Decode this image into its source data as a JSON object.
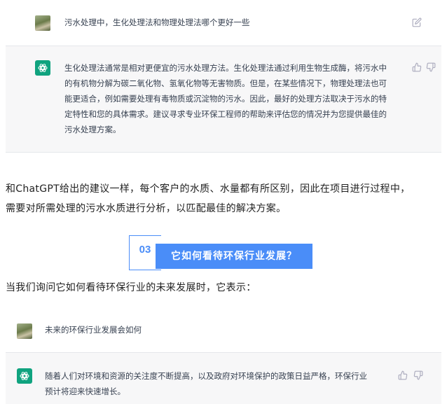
{
  "conversation1": {
    "user_message": "污水处理中，生化处理法和物理处理法哪个更好一些",
    "bot_lines": [
      "生化处理法通常是相对更便宜的污水处理方法。生化处理法通过利用生物生成酶，将污水中",
      "的有机物分解为碳二氧化物、氢氧化物等无害物质。但是，在某些情况下，物理处理法也可",
      "能更适合，例如需要处理有毒物质或沉淀物的污水。因此，最好的处理方法取决于污水的特",
      "定特性和您的具体需求。建议寻求专业环保工程师的帮助来评估您的情况并为您提供最佳的",
      "污水处理方案。"
    ]
  },
  "article": {
    "paragraph1_lines": [
      "和ChatGPT给出的建议一样，每个客户的水质、水量都有所区别，因此在项目进行过程中，",
      "需要对所需处理的污水水质进行分析，以匹配最佳的解决方案。"
    ],
    "section_number": "03",
    "section_title": "它如何看待环保行业发展？",
    "paragraph2": "当我们询问它如何看待环保行业的未来发展时，它表示："
  },
  "conversation2": {
    "user_message": "未来的环保行业发展会如何",
    "bot_lines": [
      "随着人们对环境和资源的关注度不断提高，以及政府对环境保护的政策日益严格，环保行业",
      "预计将迎来快速增长。"
    ]
  },
  "colors": {
    "accent_blue": "#4a8df8",
    "openai_green": "#10a37f",
    "bot_background": "#f7f7f8"
  },
  "icons": [
    "edit-icon",
    "thumbs-up-icon",
    "thumbs-down-icon",
    "openai-logo-icon",
    "user-avatar"
  ]
}
